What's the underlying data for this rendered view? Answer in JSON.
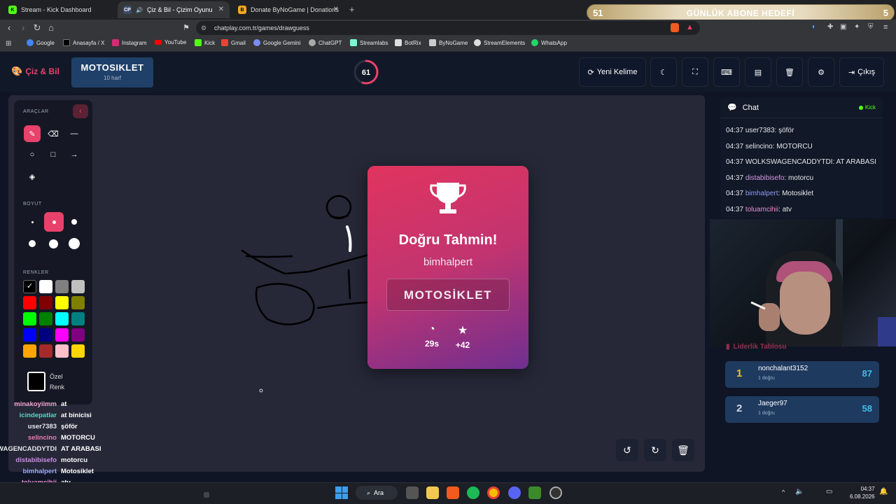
{
  "browser": {
    "tabs": [
      {
        "label": "Stream - Kick Dashboard",
        "active": false
      },
      {
        "label": "Çiz & Bil - Çizim Oyunu",
        "active": true
      },
      {
        "label": "Donate ByNoGame | Donations",
        "active": false
      }
    ],
    "new_tab": "+",
    "url": "chatplay.com.tr/games/drawguess",
    "bookmarks": [
      "Google",
      "Anasayfa / X",
      "Instagram",
      "YouTube",
      "Kick",
      "Gmail",
      "Google Gemini",
      "ChatGPT",
      "Streamlabs",
      "BotRix",
      "ByNoGame",
      "StreamElements",
      "WhatsApp"
    ]
  },
  "goal_overlay": {
    "left": "51",
    "title": "GÜNLÜK ABONE HEDEFİ",
    "right": "5"
  },
  "app": {
    "logo": "Çiz & Bil",
    "word": "MOTOSIKLET",
    "word_hint": "10 harf",
    "timer": "61",
    "timer_fraction": 0.55,
    "buttons": {
      "new_word": "Yeni Kelime",
      "exit": "Çıkış"
    }
  },
  "tools": {
    "section_tools": "ARAÇLAR",
    "section_size": "BOYUT",
    "section_colors": "RENKLER",
    "custom_color": [
      "Özel",
      "Renk"
    ],
    "colors": [
      "#000000",
      "#ffffff",
      "#808080",
      "#c0c0c0",
      "#ff0000",
      "#800000",
      "#ffff00",
      "#808000",
      "#00ff00",
      "#008000",
      "#00ffff",
      "#008080",
      "#0000ff",
      "#000080",
      "#ff00ff",
      "#800080",
      "#ffa500",
      "#a52a2a",
      "#ffc0cb",
      "#ffd700"
    ]
  },
  "modal": {
    "title": "Doğru Tahmin!",
    "user": "bimhalpert",
    "word": "MOTOSİKLET",
    "time": "29s",
    "points": "+42"
  },
  "chat": {
    "title": "Chat",
    "platform": "Kick",
    "messages": [
      {
        "time": "04:37",
        "user": "user7383",
        "text": "şöför",
        "color": "#e5e7eb"
      },
      {
        "time": "04:37",
        "user": "selincino",
        "text": "MOTORCU",
        "color": "#e5e7eb"
      },
      {
        "time": "04:37",
        "user": "WOLKSWAGENCADDYTDI",
        "text": "AT ARABASI",
        "color": "#e5e7eb"
      },
      {
        "time": "04:37",
        "user": "distabibisefo",
        "text": "motorcu",
        "color": "#d69ae6"
      },
      {
        "time": "04:37",
        "user": "bimhalpert",
        "text": "Motosiklet",
        "color": "#8f9cf0"
      },
      {
        "time": "04:37",
        "user": "toluamcihii",
        "text": "atv",
        "color": "#f08bd0"
      }
    ]
  },
  "leaderboard": {
    "title": "Liderlik Tablosu",
    "rows": [
      {
        "rank": "1",
        "name": "nonchalant3152",
        "sub": "1 doğru",
        "score": "87"
      },
      {
        "rank": "2",
        "name": "Jaeger97",
        "sub": "1 doğru",
        "score": "58"
      }
    ]
  },
  "overlay_chat": [
    {
      "user": "minakoyiimm",
      "text": "at",
      "color": "#f4a7d4"
    },
    {
      "user": "icindepatlar",
      "text": "at binicisi",
      "color": "#58d6c2"
    },
    {
      "user": "user7383",
      "text": "şöför",
      "color": "#e5e7eb"
    },
    {
      "user": "selincino",
      "text": "MOTORCU",
      "color": "#f07ab0"
    },
    {
      "user": "WAGENCADDYTDI",
      "text": "AT ARABASI",
      "color": "#e5e7eb"
    },
    {
      "user": "distabibisefo",
      "text": "motorcu",
      "color": "#d08ae6"
    },
    {
      "user": "bimhalpert",
      "text": "Motosiklet",
      "color": "#9aa8f4"
    },
    {
      "user": "toluamcihii",
      "text": "atv",
      "color": "#f08bd0"
    }
  ],
  "taskbar": {
    "search": "Ara",
    "time": "04:37",
    "date": "6.08.2026"
  }
}
